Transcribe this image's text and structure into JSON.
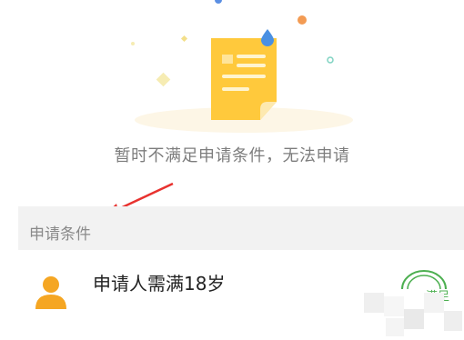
{
  "empty_state": {
    "message": "暂时不满足申请条件，无法申请",
    "icon": "document-icon"
  },
  "conditions": {
    "header": "申请条件",
    "items": [
      {
        "label": "申请人需满18岁",
        "status": "满足",
        "icon": "person-icon"
      }
    ]
  },
  "colors": {
    "document": "#ffc93c",
    "avatar": "#f5a623",
    "arrow": "#e8322f",
    "status_stamp": "#4caf50"
  }
}
